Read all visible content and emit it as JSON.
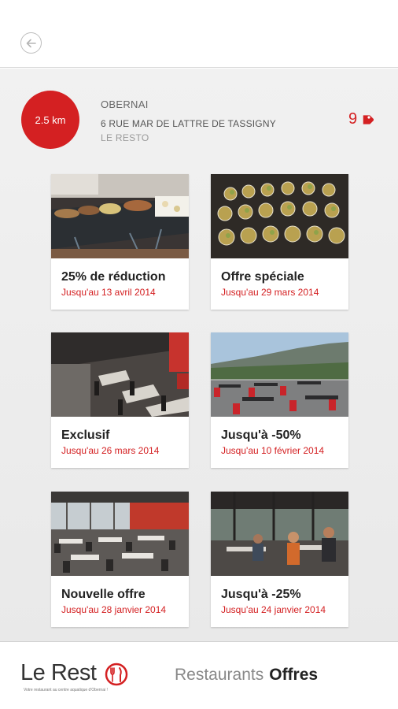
{
  "header": {
    "back_icon": "arrow-left-icon"
  },
  "restaurant": {
    "distance": "2.5 km",
    "city": "OBERNAI",
    "address": "6 RUE MAR DE LATTRE DE TASSIGNY",
    "name": "LE RESTO",
    "offer_count": "9",
    "offer_icon": "tag-icon"
  },
  "offers": [
    {
      "title": "25% de réduction",
      "date": "Jusqu'au 13 avril 2014",
      "image": "buffet-photo"
    },
    {
      "title": "Offre spéciale",
      "date": "Jusqu'au 29 mars 2014",
      "image": "verrines-photo"
    },
    {
      "title": "Exclusif",
      "date": "Jusqu'au 26 mars 2014",
      "image": "dining-room-photo"
    },
    {
      "title": "Jusqu'à -50%",
      "date": "Jusqu'au 10 février 2014",
      "image": "terrace-photo"
    },
    {
      "title": "Nouvelle offre",
      "date": "Jusqu'au 28 janvier 2014",
      "image": "restaurant-hall-photo"
    },
    {
      "title": "Jusqu'à -25%",
      "date": "Jusqu'au 24 janvier 2014",
      "image": "diners-photo"
    }
  ],
  "footer": {
    "logo_text": "Le Rest",
    "logo_tagline": "Votre restaurant au centre aquatique d'Obernai !",
    "nav_restaurants": "Restaurants",
    "nav_offres": "Offres"
  },
  "colors": {
    "accent": "#d42022",
    "background": "#ededed"
  }
}
